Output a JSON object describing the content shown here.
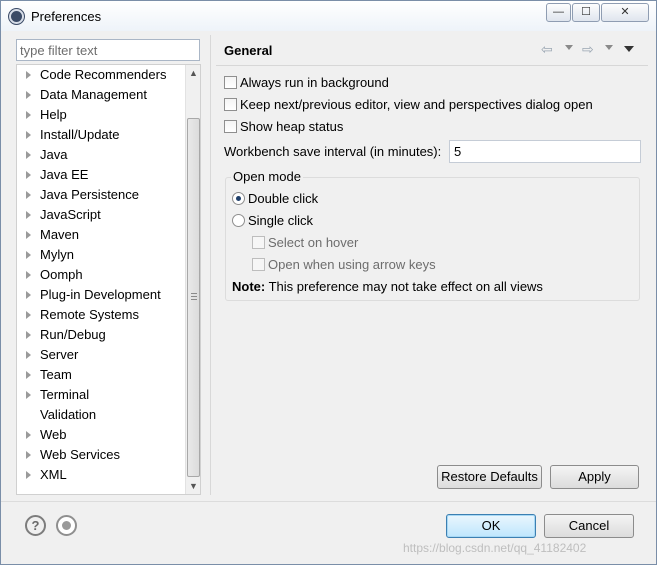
{
  "window": {
    "title": "Preferences",
    "controls": {
      "minimize": "—",
      "maximize": "☐",
      "close": "✕"
    }
  },
  "sidebar": {
    "filter_placeholder": "type filter text",
    "items": [
      {
        "label": "Code Recommenders",
        "expandable": true
      },
      {
        "label": "Data Management",
        "expandable": true
      },
      {
        "label": "Help",
        "expandable": true
      },
      {
        "label": "Install/Update",
        "expandable": true
      },
      {
        "label": "Java",
        "expandable": true
      },
      {
        "label": "Java EE",
        "expandable": true
      },
      {
        "label": "Java Persistence",
        "expandable": true
      },
      {
        "label": "JavaScript",
        "expandable": true
      },
      {
        "label": "Maven",
        "expandable": true
      },
      {
        "label": "Mylyn",
        "expandable": true
      },
      {
        "label": "Oomph",
        "expandable": true
      },
      {
        "label": "Plug-in Development",
        "expandable": true
      },
      {
        "label": "Remote Systems",
        "expandable": true
      },
      {
        "label": "Run/Debug",
        "expandable": true
      },
      {
        "label": "Server",
        "expandable": true
      },
      {
        "label": "Team",
        "expandable": true
      },
      {
        "label": "Terminal",
        "expandable": true
      },
      {
        "label": "Validation",
        "expandable": false
      },
      {
        "label": "Web",
        "expandable": true
      },
      {
        "label": "Web Services",
        "expandable": true
      },
      {
        "label": "XML",
        "expandable": true
      }
    ]
  },
  "page": {
    "title": "General",
    "options": {
      "always_run_background": {
        "label": "Always run in background",
        "checked": false
      },
      "keep_next_prev": {
        "label": "Keep next/previous editor, view and perspectives dialog open",
        "checked": false
      },
      "show_heap": {
        "label": "Show heap status",
        "checked": false
      }
    },
    "save_interval": {
      "label": "Workbench save interval (in minutes):",
      "value": "5"
    },
    "open_mode": {
      "title": "Open mode",
      "double_click": {
        "label": "Double click",
        "selected": true
      },
      "single_click": {
        "label": "Single click",
        "selected": false
      },
      "select_on_hover": {
        "label": "Select on hover",
        "enabled": false
      },
      "open_arrow_keys": {
        "label": "Open when using arrow keys",
        "enabled": false
      }
    },
    "note": {
      "prefix": "Note:",
      "text": " This preference may not take effect on all views"
    },
    "restore_defaults_label": "Restore Defaults",
    "apply_label": "Apply"
  },
  "dialog": {
    "ok_label": "OK",
    "cancel_label": "Cancel",
    "help_icon_text": "?"
  },
  "watermark": "https://blog.csdn.net/qq_41182402",
  "colors": {
    "window_bg": "#f0f0f0",
    "ok_border": "#3c7fb1",
    "radio_dot": "#1f3f6a"
  }
}
